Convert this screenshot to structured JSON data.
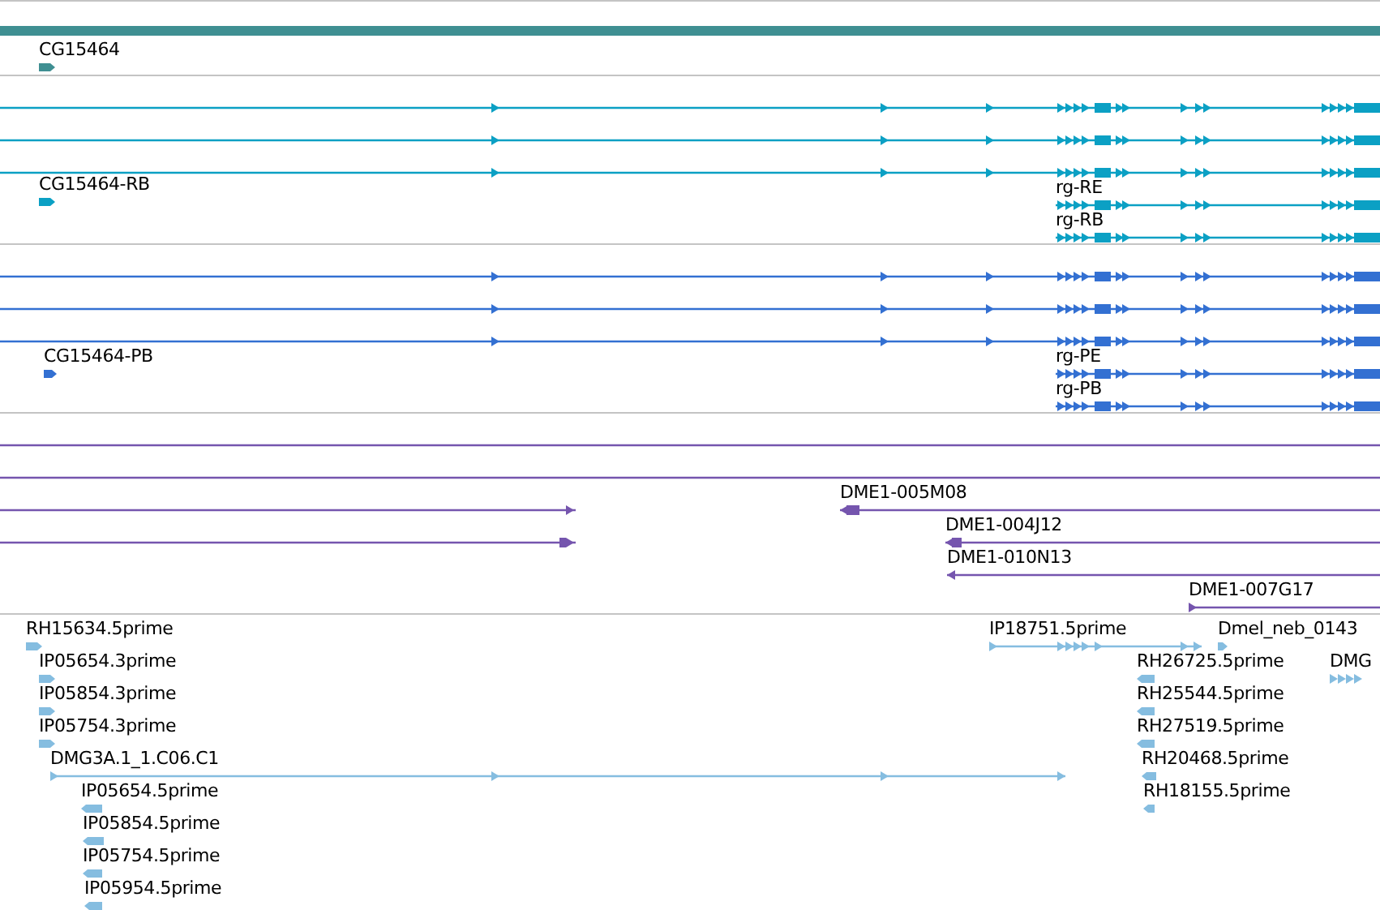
{
  "tracks": [
    {
      "color": "#3f8f92",
      "features": [
        {
          "kind": "bar"
        },
        {
          "kind": "glyph",
          "label": "CG15464",
          "reverse": false
        }
      ]
    },
    {
      "color": "#0ba0c4",
      "features": [
        {
          "kind": "transcript",
          "reverse": false
        },
        {
          "kind": "transcript",
          "reverse": false
        },
        {
          "kind": "transcript",
          "reverse": false
        },
        {
          "kind": "glyph",
          "label": "CG15464-RB",
          "reverse": false
        },
        {
          "kind": "transcript",
          "label": "rg-RE",
          "reverse": false
        },
        {
          "kind": "transcript",
          "label": "rg-RB",
          "reverse": false
        }
      ]
    },
    {
      "color": "#3370d2",
      "features": [
        {
          "kind": "transcript",
          "reverse": false
        },
        {
          "kind": "transcript",
          "reverse": false
        },
        {
          "kind": "transcript",
          "reverse": false
        },
        {
          "kind": "glyph",
          "label": "CG15464-PB",
          "reverse": false
        },
        {
          "kind": "transcript",
          "label": "rg-PE",
          "reverse": false
        },
        {
          "kind": "transcript",
          "label": "rg-PB",
          "reverse": false
        }
      ]
    },
    {
      "color": "#7555ae",
      "features": [
        {
          "kind": "transcript"
        },
        {
          "kind": "transcript"
        },
        {
          "kind": "transcript",
          "reverse": false
        },
        {
          "kind": "transcript",
          "reverse": false
        },
        {
          "kind": "transcript",
          "label": "DME1-005M08",
          "reverse": true
        },
        {
          "kind": "transcript",
          "label": "DME1-004J12",
          "reverse": true
        },
        {
          "kind": "transcript",
          "label": "DME1-010N13",
          "reverse": true
        },
        {
          "kind": "transcript",
          "label": "DME1-007G17",
          "reverse": false
        }
      ]
    },
    {
      "color": "#85bde0",
      "features": [
        {
          "kind": "glyph",
          "label": "RH15634.5prime",
          "reverse": false
        },
        {
          "kind": "glyph",
          "label": "IP05654.3prime",
          "reverse": false
        },
        {
          "kind": "glyph",
          "label": "IP05854.3prime",
          "reverse": false
        },
        {
          "kind": "glyph",
          "label": "IP05754.3prime",
          "reverse": false
        },
        {
          "kind": "transcript",
          "label": "DMG3A.1_1.C06.C1",
          "reverse": false
        },
        {
          "kind": "glyph",
          "label": "IP05654.5prime",
          "reverse": true
        },
        {
          "kind": "glyph",
          "label": "IP05854.5prime",
          "reverse": true
        },
        {
          "kind": "glyph",
          "label": "IP05754.5prime",
          "reverse": true
        },
        {
          "kind": "glyph",
          "label": "IP05954.5prime",
          "reverse": true
        },
        {
          "kind": "transcript",
          "label": "IP18751.5prime",
          "reverse": false
        },
        {
          "kind": "glyph",
          "label": "Dmel_neb_0143",
          "reverse": false
        },
        {
          "kind": "glyph",
          "label": "RH26725.5prime",
          "reverse": true
        },
        {
          "kind": "transcript",
          "label": "DMG",
          "reverse": false
        },
        {
          "kind": "glyph",
          "label": "RH25544.5prime",
          "reverse": true
        },
        {
          "kind": "glyph",
          "label": "RH27519.5prime",
          "reverse": true
        },
        {
          "kind": "glyph",
          "label": "RH20468.5prime",
          "reverse": true
        },
        {
          "kind": "glyph",
          "label": "RH18155.5prime",
          "reverse": true
        }
      ]
    }
  ]
}
